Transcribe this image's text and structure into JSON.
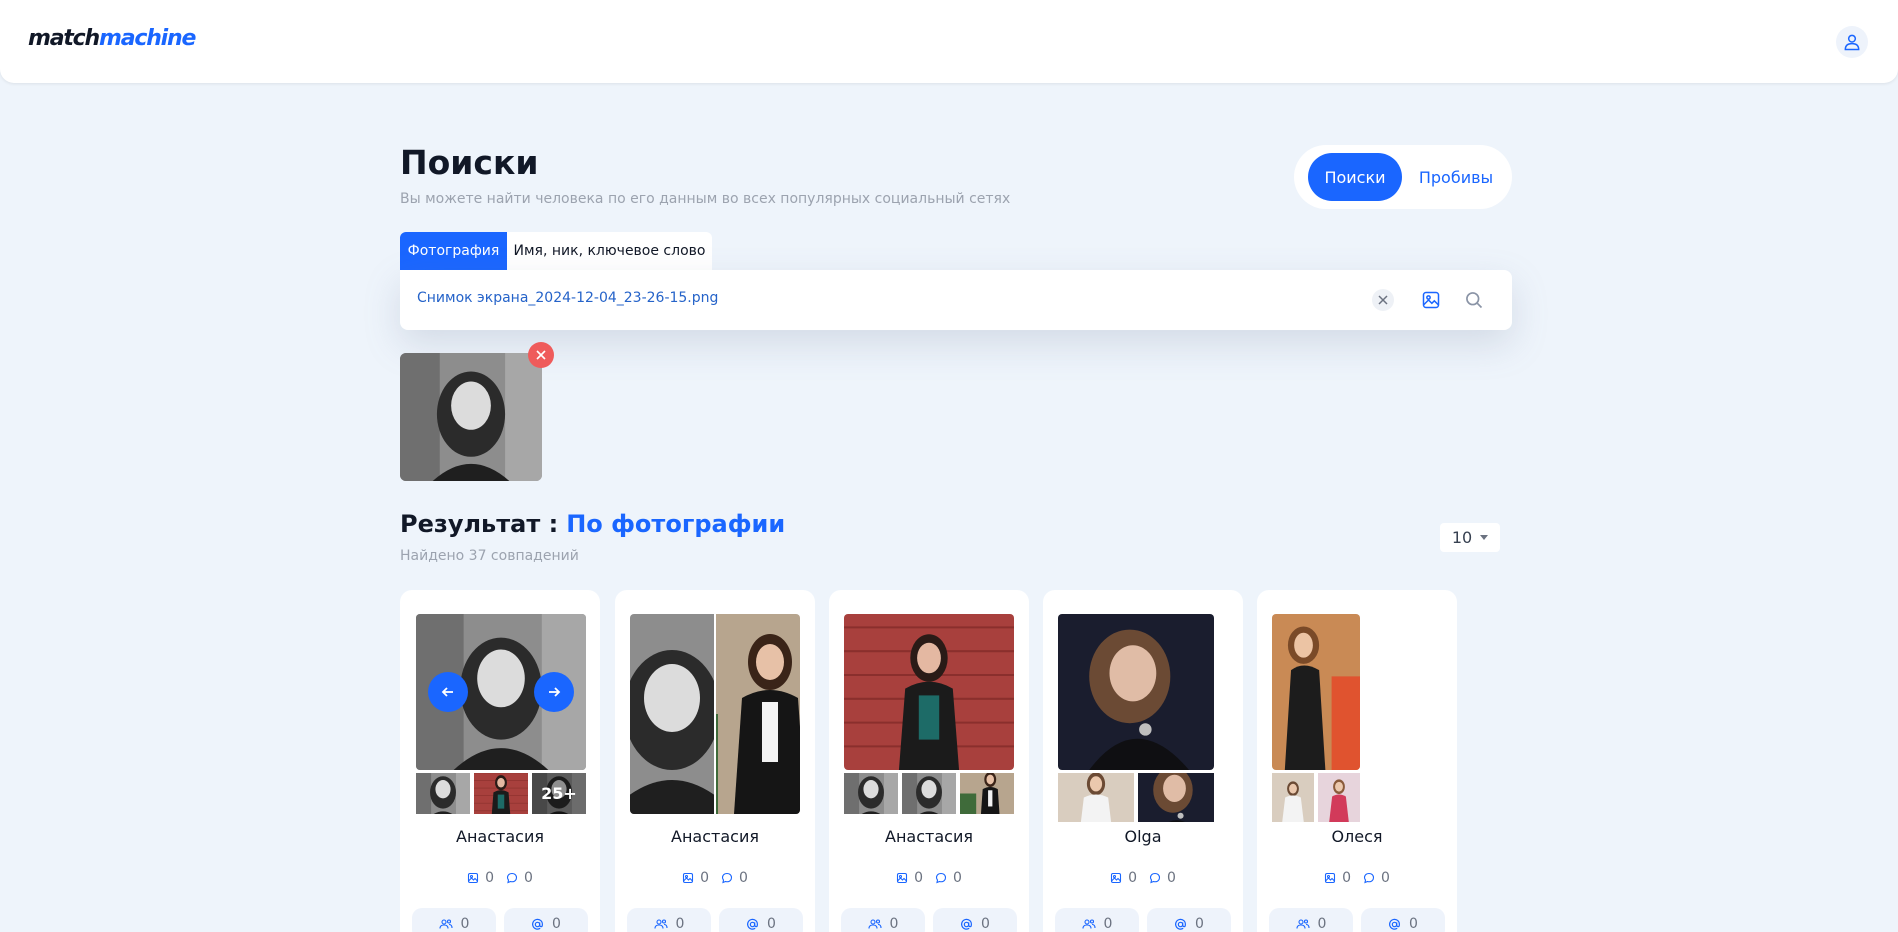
{
  "header": {
    "logo": {
      "part1": "match",
      "part2": "machine"
    },
    "user_icon": "user-icon",
    "colors": {
      "accent": "#1a66ff",
      "background": "#eef4fb"
    }
  },
  "page": {
    "title": "Поиски",
    "subtitle": "Вы можете найти человека по его данным во всех популярных социальный сетях",
    "mode_switch": {
      "active": "Поиски",
      "other": "Пробивы"
    }
  },
  "search": {
    "tabs": [
      {
        "label": "Фотография",
        "active": true
      },
      {
        "label": "Имя, ник, ключевое слово",
        "active": false
      }
    ],
    "value": "Снимок экрана_2024-12-04_23-26-15.png",
    "icons": [
      "clear-icon",
      "image-icon",
      "search-icon"
    ]
  },
  "results": {
    "title": "Результат :",
    "highlight": "По фотографии",
    "count": "Найдено 37 совпадений",
    "per_page": "10",
    "cards": [
      {
        "name": "Анастасия",
        "photos": "0",
        "comments": "0",
        "friends": "0",
        "mentions": "0",
        "more": "25+"
      },
      {
        "name": "Анастасия",
        "photos": "0",
        "comments": "0",
        "friends": "0",
        "mentions": "0"
      },
      {
        "name": "Анастасия",
        "photos": "0",
        "comments": "0",
        "friends": "0",
        "mentions": "0"
      },
      {
        "name": "Olga",
        "photos": "0",
        "comments": "0",
        "friends": "0",
        "mentions": "0"
      },
      {
        "name": "Олеся",
        "photos": "0",
        "comments": "0",
        "friends": "0",
        "mentions": "0"
      }
    ]
  }
}
